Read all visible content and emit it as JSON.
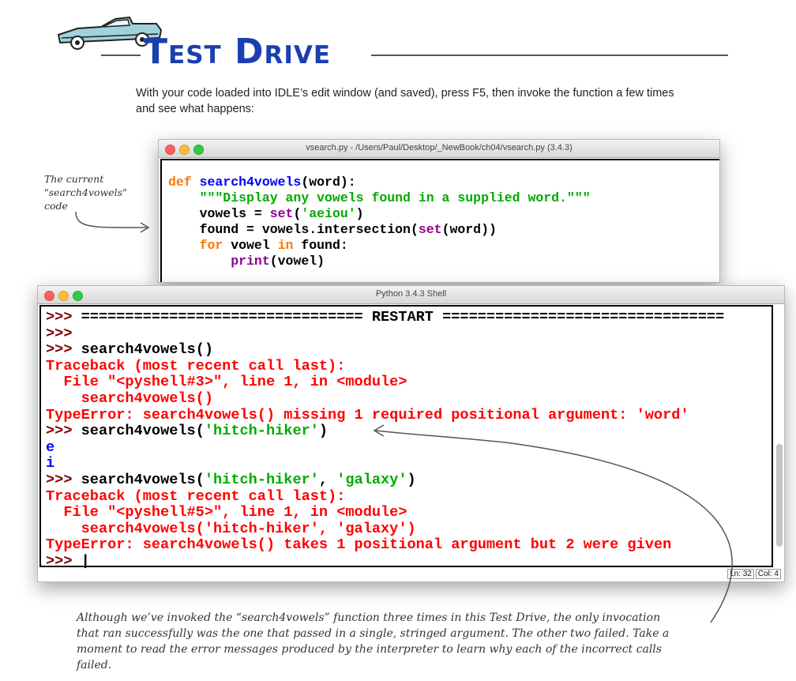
{
  "header": {
    "title": "Test Drive"
  },
  "intro": "With your code loaded into IDLE’s edit window (and saved), press F5, then invoke the function a few times and see what happens:",
  "editor_window": {
    "title": "vsearch.py - /Users/Paul/Desktop/_NewBook/ch04/vsearch.py (3.4.3)",
    "lines": [
      [
        {
          "t": "def ",
          "c": "kw"
        },
        {
          "t": "search4vowels",
          "c": "fn"
        },
        {
          "t": "(word):",
          "c": "bk"
        }
      ],
      [
        {
          "t": "    \"\"\"Display any vowels found in a supplied word.\"\"\"",
          "c": "st"
        }
      ],
      [
        {
          "t": "    vowels = ",
          "c": "bk"
        },
        {
          "t": "set",
          "c": "bi"
        },
        {
          "t": "(",
          "c": "bk"
        },
        {
          "t": "'aeiou'",
          "c": "st"
        },
        {
          "t": ")",
          "c": "bk"
        }
      ],
      [
        {
          "t": "    found = vowels.intersection(",
          "c": "bk"
        },
        {
          "t": "set",
          "c": "bi"
        },
        {
          "t": "(word))",
          "c": "bk"
        }
      ],
      [
        {
          "t": "    ",
          "c": "bk"
        },
        {
          "t": "for",
          "c": "kw"
        },
        {
          "t": " vowel ",
          "c": "bk"
        },
        {
          "t": "in",
          "c": "kw"
        },
        {
          "t": " found:",
          "c": "bk"
        }
      ],
      [
        {
          "t": "        ",
          "c": "bk"
        },
        {
          "t": "print",
          "c": "bi"
        },
        {
          "t": "(vowel)",
          "c": "bk"
        }
      ]
    ]
  },
  "shell_window": {
    "title": "Python 3.4.3 Shell",
    "lines": [
      [
        {
          "t": ">>> ",
          "c": "pr"
        },
        {
          "t": "================================ RESTART ================================",
          "c": "bk"
        }
      ],
      [
        {
          "t": ">>> ",
          "c": "pr"
        }
      ],
      [
        {
          "t": ">>> ",
          "c": "pr"
        },
        {
          "t": "search4vowels()",
          "c": "bk"
        }
      ],
      [
        {
          "t": "Traceback (most recent call last):",
          "c": "er"
        }
      ],
      [
        {
          "t": "  File \"<pyshell#3>\", line 1, in <module>",
          "c": "er"
        }
      ],
      [
        {
          "t": "    search4vowels()",
          "c": "er"
        }
      ],
      [
        {
          "t": "TypeError: search4vowels() missing 1 required positional argument: 'word'",
          "c": "er"
        }
      ],
      [
        {
          "t": ">>> ",
          "c": "pr"
        },
        {
          "t": "search4vowels(",
          "c": "bk"
        },
        {
          "t": "'hitch-hiker'",
          "c": "st"
        },
        {
          "t": ")",
          "c": "bk"
        }
      ],
      [
        {
          "t": "e",
          "c": "ou"
        }
      ],
      [
        {
          "t": "i",
          "c": "ou"
        }
      ],
      [
        {
          "t": ">>> ",
          "c": "pr"
        },
        {
          "t": "search4vowels(",
          "c": "bk"
        },
        {
          "t": "'hitch-hiker'",
          "c": "st"
        },
        {
          "t": ", ",
          "c": "bk"
        },
        {
          "t": "'galaxy'",
          "c": "st"
        },
        {
          "t": ")",
          "c": "bk"
        }
      ],
      [
        {
          "t": "Traceback (most recent call last):",
          "c": "er"
        }
      ],
      [
        {
          "t": "  File \"<pyshell#5>\", line 1, in <module>",
          "c": "er"
        }
      ],
      [
        {
          "t": "    search4vowels('hitch-hiker', 'galaxy')",
          "c": "er"
        }
      ],
      [
        {
          "t": "TypeError: search4vowels() takes 1 positional argument but 2 were given",
          "c": "er"
        }
      ],
      [
        {
          "t": ">>> ",
          "c": "pr"
        },
        {
          "t": "|",
          "c": "bk"
        }
      ]
    ],
    "status_ln": "Ln: 32",
    "status_col": "Col: 4"
  },
  "annotations": {
    "left_note": [
      "The current",
      "\"search4vowels\"",
      "code"
    ],
    "caption": "Although we’ve invoked the “search4vowels” function three times in this Test Drive, the only invocation that ran successfully was the one that passed in a single, stringed argument. The other two failed. Take a moment to read the error messages produced by the interpreter to learn why each of the incorrect calls failed."
  },
  "colors": {
    "title": "#1a3fb0",
    "keyword": "#ff7700",
    "function_name": "#0000ff",
    "string": "#00aa00",
    "builtin": "#900090",
    "prompt": "#800000",
    "error": "#ff0000",
    "output": "#0000ff"
  }
}
